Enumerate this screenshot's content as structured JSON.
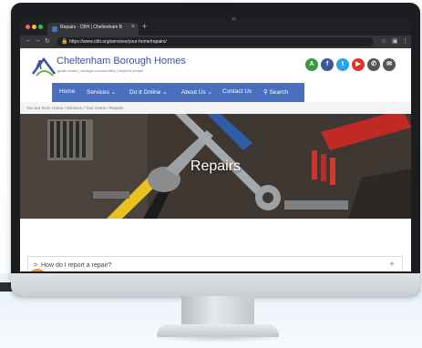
{
  "browser": {
    "tab_title": "Repairs - CBH | Cheltenham B",
    "tab_close": "×",
    "new_tab": "+",
    "url": "https://www.cbh.org/services/your-home/repairs/"
  },
  "site": {
    "name": "Cheltenham Borough Homes",
    "tagline": "great homes | stronger communities | inspired people",
    "social": [
      {
        "icon": "accessibility-icon",
        "glyph": "A",
        "color": "#3a9a3e"
      },
      {
        "icon": "facebook-icon",
        "glyph": "f",
        "color": "#3b5998"
      },
      {
        "icon": "twitter-icon",
        "glyph": "t",
        "color": "#2aa3ef"
      },
      {
        "icon": "youtube-icon",
        "glyph": "▶",
        "color": "#e0352b"
      },
      {
        "icon": "phone-icon",
        "glyph": "✆",
        "color": "#555555"
      },
      {
        "icon": "email-icon",
        "glyph": "✉",
        "color": "#555555"
      }
    ]
  },
  "nav": {
    "home": "Home",
    "services": "Services ⌄",
    "do_it_online": "Do It Online ⌄",
    "about_us": "About Us ⌄",
    "contact_us": "Contact Us",
    "search": "Search"
  },
  "breadcrumb": "You are here: Home / Services / Your Home / Repairs",
  "hero": {
    "title": "Repairs"
  },
  "accordion": {
    "arrow": ">",
    "question": "How do I report a repair?",
    "toggle": "+"
  },
  "colors": {
    "brand": "#3d4f9e",
    "nav": "#4b6fbf",
    "chat": "#f3952a"
  }
}
